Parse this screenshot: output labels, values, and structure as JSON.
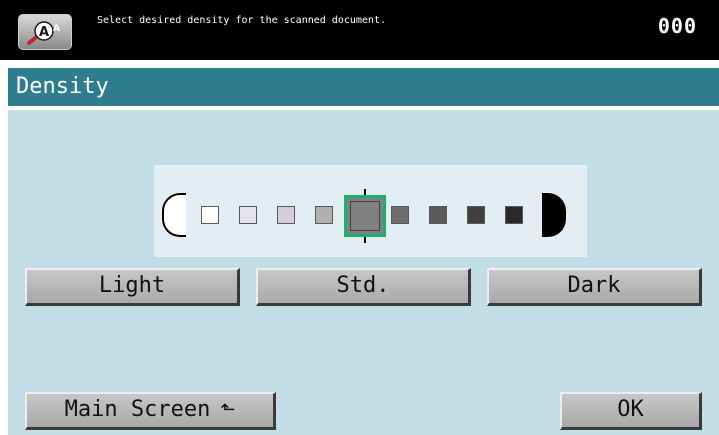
{
  "header": {
    "help_icon": "accessibility-help-icon",
    "message": "Select desired density for the scanned document.",
    "counter": "000"
  },
  "title": "Density",
  "density": {
    "levels": 9,
    "selected_level": 5,
    "step_colors": [
      "#ffffff",
      "#e4e4ec",
      "#d0d0d8",
      "#b0b0b0",
      "#808080",
      "#6e6e6e",
      "#5a5a5a",
      "#404040",
      "#2a2a2a"
    ]
  },
  "buttons": {
    "light": "Light",
    "std": "Std.",
    "dark": "Dark",
    "main_screen": "Main Screen",
    "ok": "OK"
  },
  "colors": {
    "title_bar": "#2e7d8e",
    "panel": "#c2dde6",
    "selection": "#18b06a"
  }
}
